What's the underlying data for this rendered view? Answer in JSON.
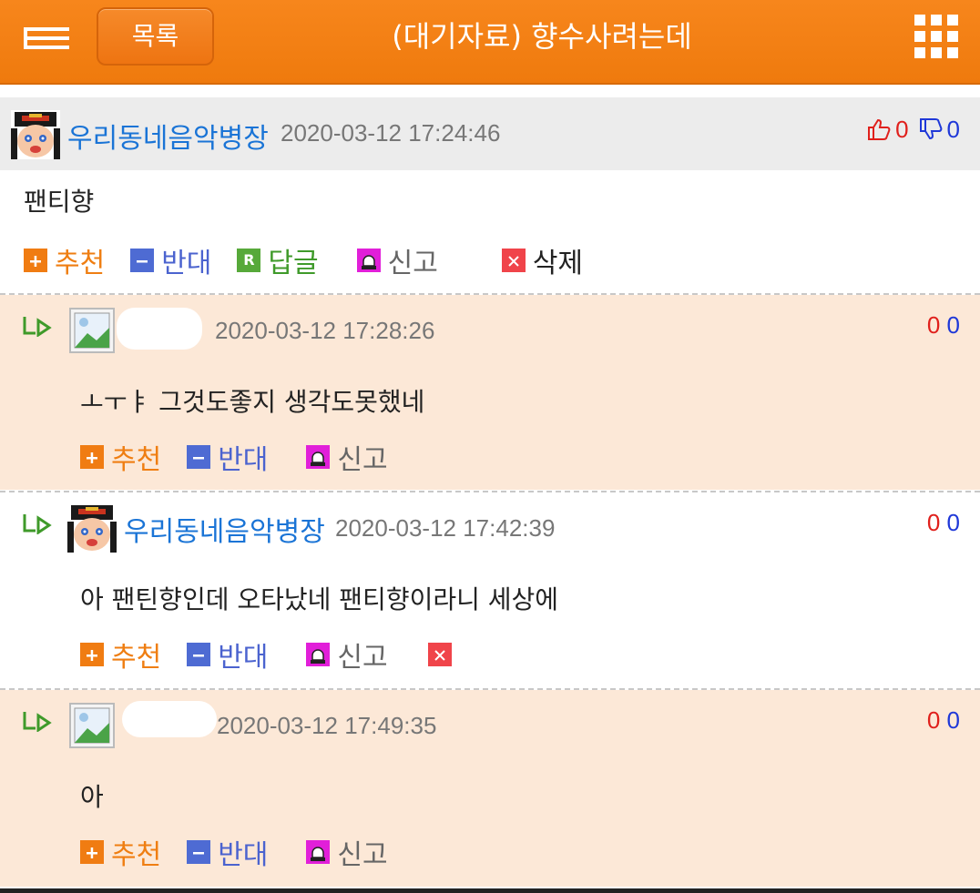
{
  "header": {
    "list_button": "목록",
    "title": "(대기자료) 향수사려는데"
  },
  "post": {
    "author": "우리동네음악병장",
    "date": "2020-03-12 17:24:46",
    "up_votes": "0",
    "down_votes": "0",
    "body": "팬티향",
    "actions": {
      "recommend": "추천",
      "oppose": "반대",
      "reply": "답글",
      "report": "신고",
      "delete": "삭제"
    }
  },
  "comments": [
    {
      "author": "",
      "date": "2020-03-12 17:28:26",
      "up": "0",
      "down": "0",
      "text": "ㅗㅜㅑ 그것도좋지 생각도못했네"
    },
    {
      "author": "우리동네음악병장",
      "date": "2020-03-12 17:42:39",
      "up": "0",
      "down": "0",
      "text": "아 팬틴향인데 오타났네 팬티향이라니 세상에"
    },
    {
      "author": "",
      "date": "2020-03-12 17:49:35",
      "up": "0",
      "down": "0",
      "text": "아"
    }
  ],
  "comment_actions": {
    "recommend": "추천",
    "oppose": "반대",
    "report": "신고"
  },
  "colors": {
    "header_orange": "#f07f14",
    "link_blue": "#1a74d6",
    "up_red": "#e0201c",
    "down_blue": "#1f38d8",
    "comment_bg": "#fce8d7"
  }
}
